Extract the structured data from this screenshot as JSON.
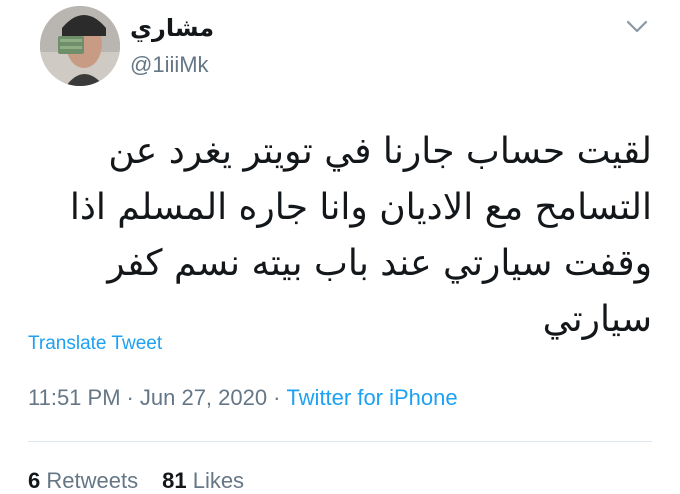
{
  "user": {
    "display_name": "مشاري",
    "handle": "@1iiiMk"
  },
  "tweet": {
    "text": "لقيت حساب جارنا في تويتر يغرد عن\nالتسامح مع الاديان وانا جاره المسلم اذا\nوقفت سيارتي عند باب بيته نسم كفر\nسيارتي",
    "translate_label": "Translate Tweet",
    "time": "11:51 PM",
    "separator": "·",
    "date": "Jun 27, 2020",
    "source": "Twitter for iPhone"
  },
  "stats": {
    "retweets_count": "6",
    "retweets_label": "Retweets",
    "likes_count": "81",
    "likes_label": "Likes"
  },
  "icons": {
    "menu": "chevron-down-icon"
  },
  "colors": {
    "accent": "#1da1f2",
    "secondary_text": "#657786",
    "primary_text": "#14171a",
    "divider": "#e1e8ed"
  }
}
